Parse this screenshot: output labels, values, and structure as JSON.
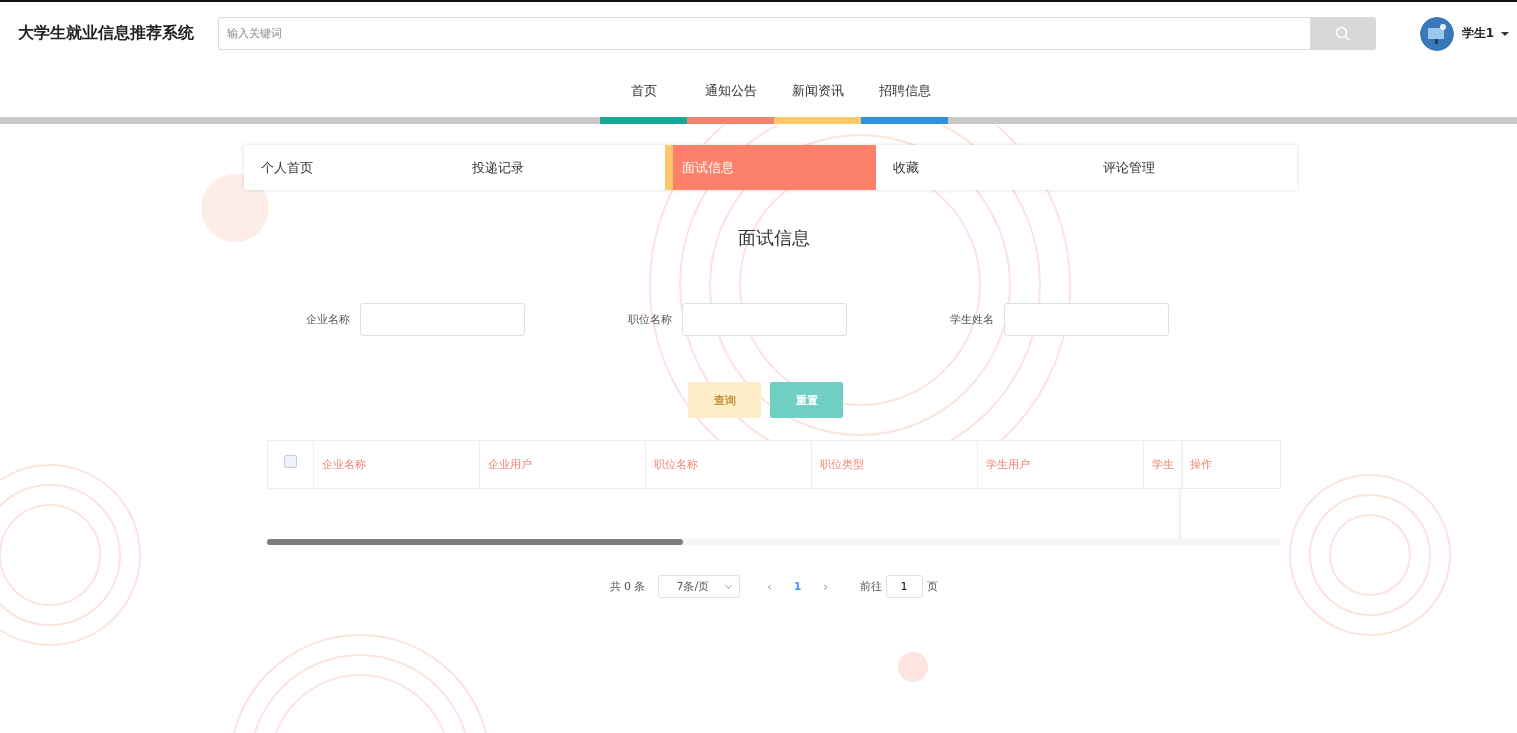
{
  "header": {
    "title": "大学生就业信息推荐系统",
    "search": {
      "placeholder": "输入关键词"
    },
    "user": {
      "name": "学生1"
    }
  },
  "nav": [
    {
      "label": "首页",
      "color": "#17a998"
    },
    {
      "label": "通知公告",
      "color": "#f5826c"
    },
    {
      "label": "新闻资讯",
      "color": "#fcc86a"
    },
    {
      "label": "招聘信息",
      "color": "#2d93e0"
    }
  ],
  "subtabs": [
    {
      "label": "个人首页",
      "selected": false
    },
    {
      "label": "投递记录",
      "selected": false
    },
    {
      "label": "面试信息",
      "selected": true
    },
    {
      "label": "收藏",
      "selected": false
    },
    {
      "label": "评论管理",
      "selected": false
    }
  ],
  "page_title": "面试信息",
  "filters": [
    {
      "label": "企业名称"
    },
    {
      "label": "职位名称"
    },
    {
      "label": "学生姓名"
    }
  ],
  "buttons": [
    {
      "label": "查询",
      "kind": "query"
    },
    {
      "label": "重置",
      "kind": "reset"
    }
  ],
  "table": {
    "select_all": {
      "checked": false
    },
    "columns": [
      "企业名称",
      "企业用户",
      "职位名称",
      "职位类型",
      "学生用户",
      "学生"
    ],
    "fixed_column": "操作"
  },
  "pagination": {
    "total": "共 0 条",
    "page_size": "7条/页",
    "prev": "‹",
    "current": "1",
    "next": "›",
    "goto_label": "前往",
    "goto_value": "1",
    "goto_suffix": "页"
  }
}
